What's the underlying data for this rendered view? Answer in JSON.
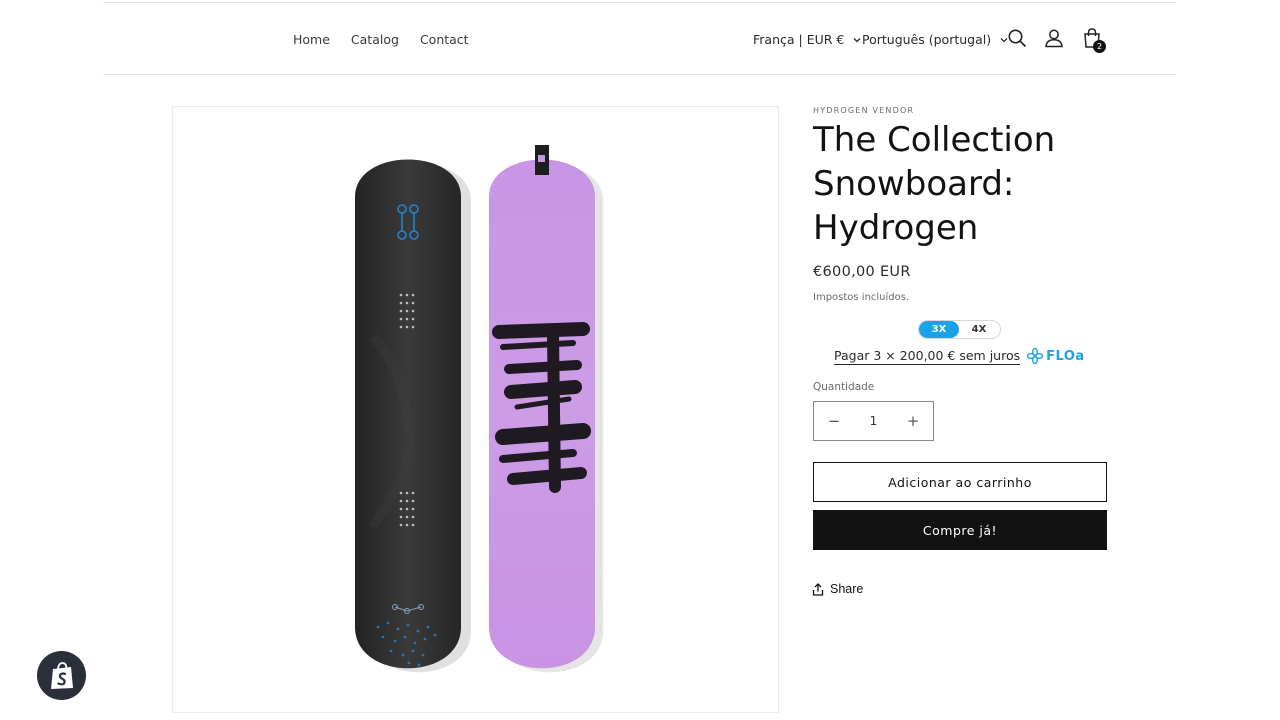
{
  "header": {
    "nav": [
      "Home",
      "Catalog",
      "Contact"
    ],
    "country_selector": "França | EUR €",
    "language_selector": "Português (portugal)",
    "cart_count": "2"
  },
  "product": {
    "vendor": "HYDROGEN VENDOR",
    "title": "The Collection Snowboard: Hydrogen",
    "price": "€600,00 EUR",
    "tax_note": "Impostos incluídos.",
    "board_graphic_text": "H2"
  },
  "floa": {
    "options": [
      "3X",
      "4X"
    ],
    "selected": "3X",
    "installment_text": "Pagar 3 × 200,00 € sem juros",
    "brand": "FLOa",
    "brand_color": "#1ba3e8"
  },
  "quantity": {
    "label": "Quantidade",
    "value": "1",
    "decrease": "−",
    "increase": "+"
  },
  "actions": {
    "add_to_cart": "Adicionar ao carrinho",
    "buy_now": "Compre já!",
    "share": "Share"
  },
  "colors": {
    "primary_button": "#121212",
    "board_left": "#2c2c2c",
    "board_right": "#cb98e6"
  }
}
